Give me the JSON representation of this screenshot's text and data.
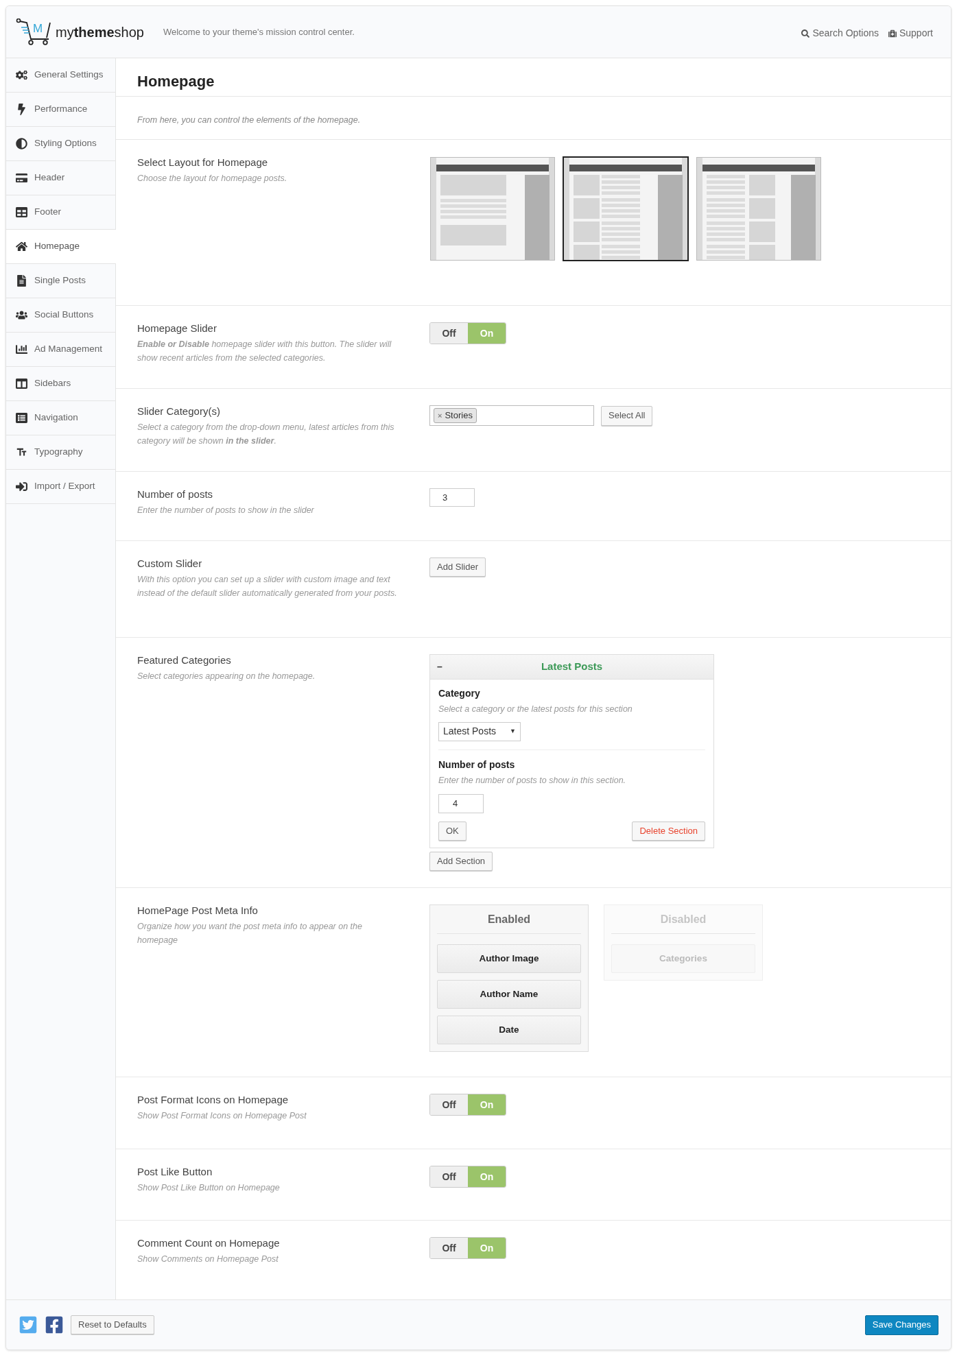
{
  "header": {
    "logo_mark": "M",
    "logo_text": "my**theme**shop",
    "tagline": "Welcome to your theme's mission control center.",
    "links": [
      "Search Options",
      "Support"
    ]
  },
  "sidebar": {
    "items": [
      {
        "label": "General Settings",
        "selected": false
      },
      {
        "label": "Performance",
        "selected": false
      },
      {
        "label": "Styling Options",
        "selected": false
      },
      {
        "label": "Header",
        "selected": false
      },
      {
        "label": "Footer",
        "selected": false
      },
      {
        "label": "Homepage",
        "selected": true
      },
      {
        "label": "Single Posts",
        "selected": false
      },
      {
        "label": "Social Buttons",
        "selected": false
      },
      {
        "label": "Ad Management",
        "selected": false
      },
      {
        "label": "Sidebars",
        "selected": false
      },
      {
        "label": "Navigation",
        "selected": false
      },
      {
        "label": "Typography",
        "selected": false
      },
      {
        "label": "Import / Export",
        "selected": false
      }
    ]
  },
  "page": {
    "title": "Homepage",
    "intro": "From here, you can control the elements of the homepage."
  },
  "settings": [
    {
      "kind": "layout",
      "title": "Select Layout for Homepage",
      "description": "Choose the layout for homepage posts.",
      "layouts": [
        {
          "selected": false
        },
        {
          "selected": true
        },
        {
          "selected": false
        }
      ]
    },
    {
      "kind": "toggle",
      "title": "Homepage Slider",
      "description": "**Enable or Disable** homepage slider with this button. The slider will show recent articles from the selected categories.",
      "off_label": "Off",
      "on_label": "On",
      "on": true
    },
    {
      "kind": "tags",
      "title": "Slider Category(s)",
      "description": "Select a category from the drop-down menu, latest articles from this category will be shown **in the slider**.",
      "remove_mark": "×",
      "tags": [
        "Stories"
      ],
      "button": "Select All"
    },
    {
      "kind": "number",
      "title": "Number of posts",
      "description": "Enter the number of posts to show in the slider",
      "value": "3"
    },
    {
      "kind": "button",
      "title": "Custom Slider",
      "description": "With this option you can set up a slider with custom image and text instead of the default slider automatically generated from your posts.",
      "button": "Add Slider"
    },
    {
      "kind": "featured",
      "title": "Featured Categories",
      "description": "Select categories appearing on the homepage.",
      "collapse_mark": "–",
      "section_title": "Latest Posts",
      "category_label": "Category",
      "category_description": "Select a category or the latest posts for this section",
      "category_value": "Latest Posts",
      "caret": "▼",
      "count_label": "Number of posts",
      "count_description": "Enter the number of posts to show in this section.",
      "count_value": "4",
      "ok_button": "OK",
      "delete_button": "Delete Section",
      "add_button": "Add Section"
    },
    {
      "kind": "sorter",
      "title": "HomePage Post Meta Info",
      "description": "Organize how you want the post meta info to appear on the homepage",
      "columns": [
        {
          "title": "Enabled",
          "enabled": true,
          "items": [
            "Author Image",
            "Author Name",
            "Date"
          ]
        },
        {
          "title": "Disabled",
          "enabled": false,
          "items": [
            "Categories"
          ]
        }
      ]
    },
    {
      "kind": "toggle",
      "title": "Post Format Icons on Homepage",
      "description": "Show Post Format Icons on Homepage Post",
      "off_label": "Off",
      "on_label": "On",
      "on": true
    },
    {
      "kind": "toggle",
      "title": "Post Like Button",
      "description": "Show Post Like Button on Homepage",
      "off_label": "Off",
      "on_label": "On",
      "on": true
    },
    {
      "kind": "toggle",
      "title": "Comment Count on Homepage",
      "description": "Show Comments on Homepage Post",
      "off_label": "Off",
      "on_label": "On",
      "on": true
    }
  ],
  "footer": {
    "reset_button": "Reset to Defaults",
    "save_button": "Save Changes"
  }
}
